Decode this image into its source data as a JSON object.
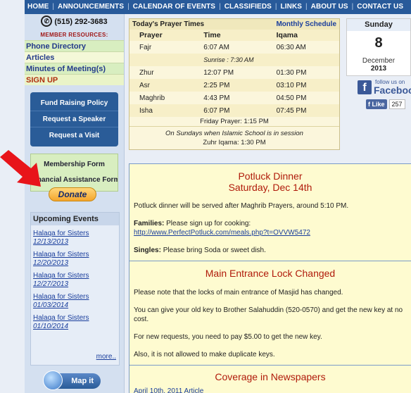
{
  "topnav": [
    "HOME",
    "ANNOUNCEMENTS",
    "CALENDAR OF EVENTS",
    "CLASSIFIEDS",
    "LINKS",
    "ABOUT US",
    "CONTACT US"
  ],
  "sidebar": {
    "phone": "(515) 292-3683",
    "member_title": "MEMBER RESOURCES:",
    "member_links": [
      "Phone Directory",
      "Articles",
      "Minutes of Meeting(s)",
      "SIGN UP"
    ],
    "blue_buttons": [
      "Fund Raising Policy",
      "Request a Speaker",
      "Request a Visit"
    ],
    "green_buttons": [
      "Membership Form",
      "Financial Assistance Form"
    ],
    "donate": "Donate",
    "events_title": "Upcoming Events",
    "events": [
      {
        "title": "Halaqa for Sisters",
        "date": "12/13/2013"
      },
      {
        "title": "Halaqa for Sisters",
        "date": "12/20/2013"
      },
      {
        "title": "Halaqa for Sisters",
        "date": "12/27/2013"
      },
      {
        "title": "Halaqa for Sisters",
        "date": "01/03/2014"
      },
      {
        "title": "Halaqa for Sisters",
        "date": "01/10/2014"
      }
    ],
    "more": "more..",
    "mapit": "Map it"
  },
  "prayer": {
    "title": "Today's Prayer Times",
    "schedule_link": "Monthly Schedule",
    "headers": [
      "Prayer",
      "Time",
      "Iqama"
    ],
    "rows": [
      {
        "name": "Fajr",
        "time": "6:07 AM",
        "iqama": "06:30 AM"
      },
      {
        "name": "Zhur",
        "time": "12:07 PM",
        "iqama": "01:30 PM"
      },
      {
        "name": "Asr",
        "time": "2:25 PM",
        "iqama": "03:10 PM"
      },
      {
        "name": "Maghrib",
        "time": "4:43 PM",
        "iqama": "04:50 PM"
      },
      {
        "name": "Isha",
        "time": "6:07 PM",
        "iqama": "07:45 PM"
      }
    ],
    "sunrise": "Sunrise : 7:30 AM",
    "friday": "Friday Prayer: 1:15 PM",
    "sunday_note": "On Sundays when Islamic School is in session",
    "sunday_iqama": "Zuhr Iqama: 1:30 PM"
  },
  "date": {
    "dow": "Sunday",
    "day": "8",
    "month": "December",
    "year": "2013"
  },
  "facebook": {
    "follow_small": "follow us on",
    "follow_big": "Facebook",
    "like": "Like",
    "count": "257"
  },
  "news": {
    "n1_title1": "Potluck Dinner",
    "n1_title2": "Saturday, Dec 14th",
    "n1_p1": "Potluck dinner will be served after Maghrib Prayers, around 5:10 PM.",
    "n1_families_label": "Families:",
    "n1_families_text": "Please sign up for cooking:",
    "n1_link": "http://www.PerfectPotluck.com/meals.php?t=OVVW5472",
    "n1_singles_label": "Singles:",
    "n1_singles_text": "Please bring Soda or sweet dish.",
    "n2_title": "Main Entrance Lock Changed",
    "n2_p1": "Please note that the locks of main entrance of Masjid has changed.",
    "n2_p2": "You can give your old key to Brother Salahuddin (520-0570) and get the new key at no cost.",
    "n2_p3": "For new requests, you need to pay $5.00 to get the new key.",
    "n2_p4": "Also, it is not allowed to make duplicate keys.",
    "n3_title": "Coverage in Newspapers",
    "n3_link": "April 10th, 2011 Article"
  },
  "colors": {
    "nav": "#285a9a",
    "news_title": "#b01a0a",
    "donate": "#f4a52c"
  }
}
